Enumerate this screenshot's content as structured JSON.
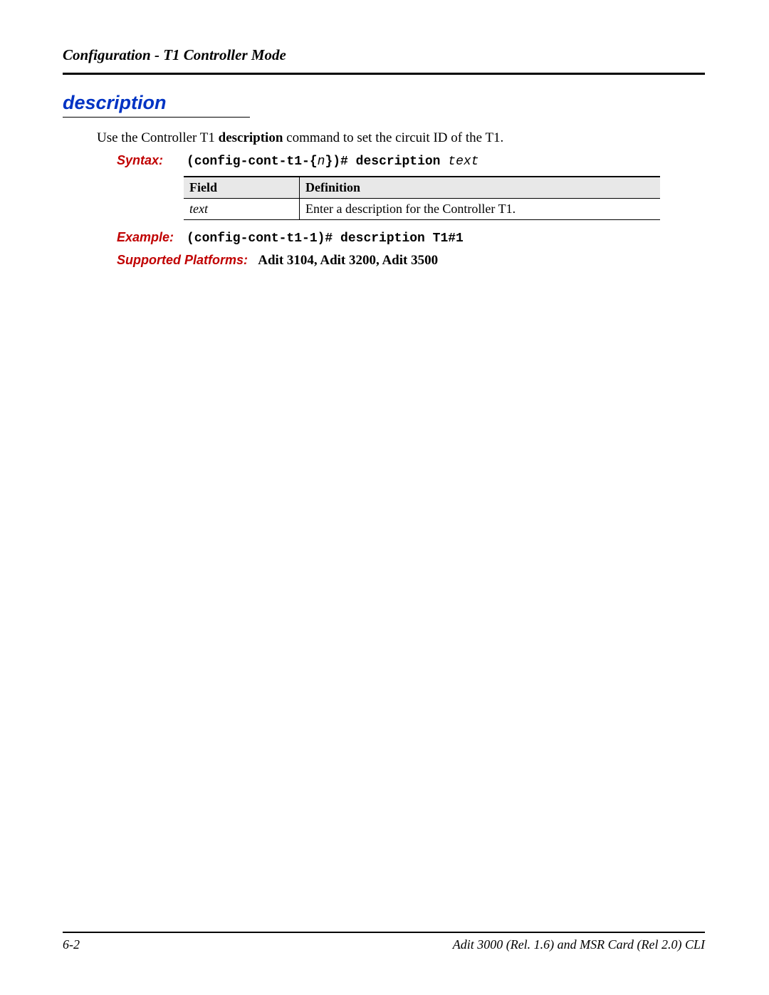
{
  "header": {
    "title": "Configuration - T1 Controller Mode"
  },
  "section": {
    "heading": "description",
    "intro_pre": "Use the Controller T1 ",
    "intro_bold": "description",
    "intro_post": " command to set the circuit ID of the T1.",
    "syntax": {
      "label": "Syntax:",
      "pre": "(config-cont-t1-{",
      "n": "n",
      "mid": "})# description ",
      "arg": "text"
    },
    "table": {
      "headers": {
        "field": "Field",
        "definition": "Definition"
      },
      "row": {
        "field": "text",
        "definition": "Enter a description for the Controller T1."
      }
    },
    "example": {
      "label": "Example:",
      "text": "(config-cont-t1-1)# description T1#1"
    },
    "platforms": {
      "label": "Supported Platforms:",
      "value": "Adit 3104, Adit 3200, Adit 3500"
    }
  },
  "footer": {
    "page": "6-2",
    "doc": "Adit 3000 (Rel. 1.6) and MSR Card (Rel 2.0) CLI"
  }
}
